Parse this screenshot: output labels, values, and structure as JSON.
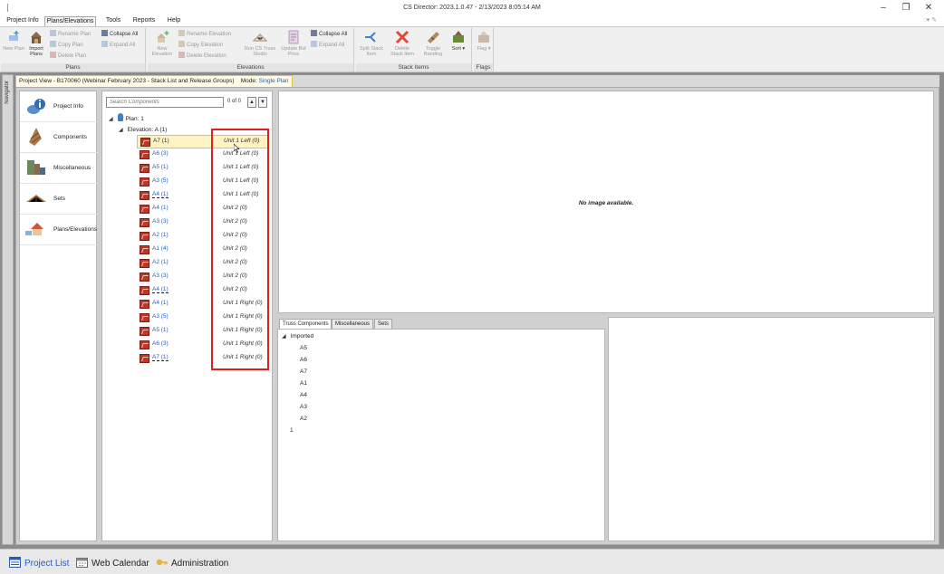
{
  "window": {
    "title": "CS Director: 2023.1.0.47 - 2/13/2023 8:05:14 AM",
    "minimize": "–",
    "maximize": "❐",
    "close": "✕"
  },
  "menu": {
    "tabs": [
      "Project Info",
      "Plans/Elevations",
      "Tools",
      "Reports",
      "Help"
    ],
    "active": "Plans/Elevations"
  },
  "ribbon": {
    "plans": {
      "label": "Plans",
      "new_plan": "New Plan",
      "import_plans": "Import Plans",
      "rename_plan": "Rename Plan",
      "copy_plan": "Copy Plan",
      "delete_plan": "Delete Plan",
      "collapse_all": "Collapse All",
      "expand_all": "Expand All"
    },
    "elevations": {
      "label": "Elevations",
      "new_elevation": "New Elevation",
      "rename_elevation": "Rename Elevation",
      "copy_elevation": "Copy Elevation",
      "delete_elevation": "Delete Elevation",
      "run_cs_truss_studio": "Run CS Truss Studio",
      "update_bid_price": "Update Bid Price",
      "collapse_all": "Collapse All",
      "expand_all": "Expand All"
    },
    "stack_items": {
      "label": "Stack Items",
      "split_stack_item": "Split Stack Item",
      "delete_stack_item": "Delete Stack Item",
      "toggle_banding": "Toggle Banding",
      "sort": "Sort"
    },
    "flags": {
      "label": "Flags",
      "flag": "Flag"
    }
  },
  "navigator_label": "Navigator",
  "document_tab": {
    "title": "Project View - B170060 (Webinar February 2023 - Stack List and Release Groups)",
    "mode_label": "Mode:",
    "mode_value": "Single Plan"
  },
  "left_nav": [
    "Project Info",
    "Components",
    "Miscellaneous",
    "Sets",
    "Plans/Elevations"
  ],
  "tree": {
    "search_placeholder": "Search Components",
    "count": "0 of 0",
    "up": "▲",
    "down": "▼",
    "plan": "Plan: 1",
    "elevation": "Elevation: A (1)",
    "rows": [
      {
        "name": "A7 (1)",
        "group": "Unit 1 Left (0)"
      },
      {
        "name": "A6 (3)",
        "group": "Unit 1 Left (0)"
      },
      {
        "name": "A5 (1)",
        "group": "Unit 1 Left (0)"
      },
      {
        "name": "A3 (5)",
        "group": "Unit 1 Left (0)"
      },
      {
        "name": "A4 (1)",
        "group": "Unit 1 Left (0)"
      },
      {
        "name": "A4 (1)",
        "group": "Unit 2 (0)"
      },
      {
        "name": "A3 (3)",
        "group": "Unit 2 (0)"
      },
      {
        "name": "A2 (1)",
        "group": "Unit 2 (0)"
      },
      {
        "name": "A1 (4)",
        "group": "Unit 2 (0)"
      },
      {
        "name": "A2 (1)",
        "group": "Unit 2 (0)"
      },
      {
        "name": "A3 (3)",
        "group": "Unit 2 (0)"
      },
      {
        "name": "A4 (1)",
        "group": "Unit 2 (0)"
      },
      {
        "name": "A4 (1)",
        "group": "Unit 1 Right (0)"
      },
      {
        "name": "A3 (5)",
        "group": "Unit 1 Right (0)"
      },
      {
        "name": "A5 (1)",
        "group": "Unit 1 Right (0)"
      },
      {
        "name": "A6 (3)",
        "group": "Unit 1 Right (0)"
      },
      {
        "name": "A7 (1)",
        "group": "Unit 1 Right (0)"
      }
    ]
  },
  "image_panel": {
    "message": "No image available."
  },
  "components_tabs": [
    "Truss Components",
    "Miscellaneous",
    "Sets"
  ],
  "components_list": {
    "group": "Imported",
    "items": [
      "A5",
      "A6",
      "A7",
      "A1",
      "A4",
      "A3",
      "A2"
    ],
    "footer": "1"
  },
  "statusbar": {
    "project_list": "Project List",
    "web_calendar": "Web Calendar",
    "administration": "Administration"
  },
  "colors": {
    "accent_blue": "#2a5db0",
    "highlight_yellow": "#fff3c4",
    "red_box": "#e02020"
  }
}
